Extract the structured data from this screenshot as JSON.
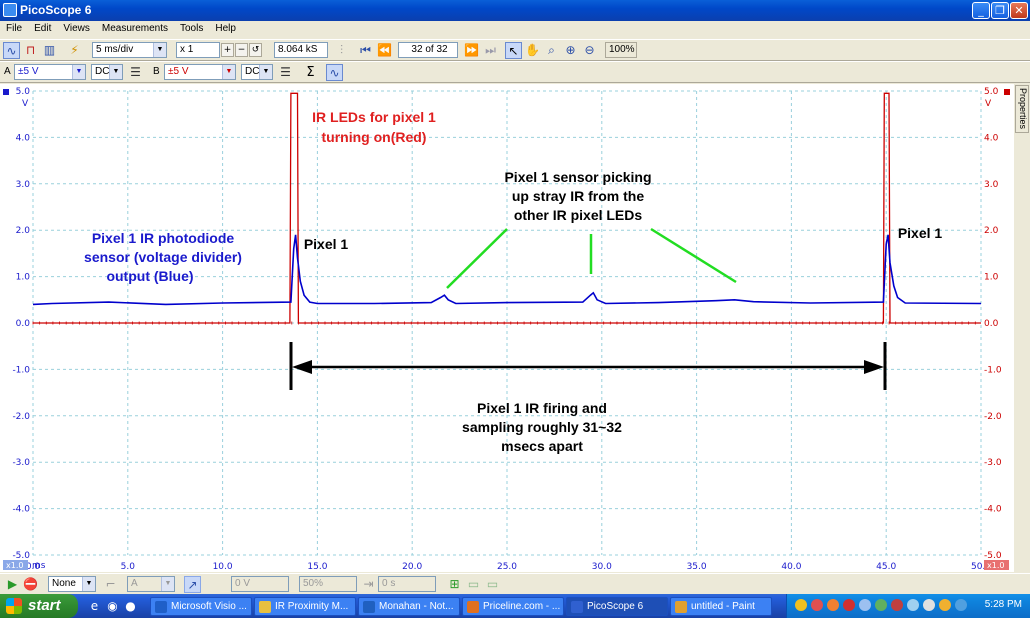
{
  "window": {
    "title": "PicoScope 6"
  },
  "menu": [
    "File",
    "Edit",
    "Views",
    "Measurements",
    "Tools",
    "Help"
  ],
  "toolbar1": {
    "timebase": "5 ms/div",
    "zoom": "x 1",
    "samples": "8.064 kS",
    "buffer": "32 of 32",
    "zoom_pct": "100%"
  },
  "toolbar2": {
    "chA_label": "A",
    "chA_range": "±5 V",
    "chA_coupling": "DC",
    "chB_label": "B",
    "chB_range": "±5 V",
    "chB_coupling": "DC",
    "sigma": "Σ"
  },
  "properties_tab": "Properties",
  "chart_data": {
    "type": "line",
    "xlim": [
      0,
      50
    ],
    "ylim": [
      -5,
      5
    ],
    "x_ticks": [
      "0.0",
      "5.0",
      "10.0",
      "15.0",
      "20.0",
      "25.0",
      "30.0",
      "35.0",
      "40.0",
      "45.0",
      "50.0"
    ],
    "y_ticks": [
      "5.0",
      "4.0",
      "3.0",
      "2.0",
      "1.0",
      "0.0",
      "-1.0",
      "-2.0",
      "-3.0",
      "-4.0",
      "-5.0"
    ],
    "y_unit": "V",
    "x_unit": "ms",
    "x_scale_badge": "x1.0",
    "grid": true,
    "series": [
      {
        "color": "#0000cc",
        "x": [
          0,
          1,
          4,
          7,
          10,
          13.6,
          13.75,
          13.85,
          13.95,
          14.1,
          14.3,
          14.6,
          15,
          18,
          21,
          21.5,
          21.7,
          21.9,
          22.3,
          25,
          29,
          29.4,
          29.55,
          29.75,
          30.2,
          33,
          36,
          37,
          38,
          41,
          44.85,
          45.0,
          45.1,
          45.2,
          45.4,
          45.6,
          46,
          50
        ],
        "y": [
          0.4,
          0.42,
          0.45,
          0.4,
          0.43,
          0.45,
          1.6,
          1.9,
          1.4,
          0.9,
          0.6,
          0.45,
          0.42,
          0.42,
          0.44,
          0.55,
          0.6,
          0.5,
          0.42,
          0.44,
          0.45,
          0.6,
          0.65,
          0.5,
          0.42,
          0.44,
          0.48,
          0.5,
          0.46,
          0.43,
          0.45,
          1.7,
          1.9,
          1.3,
          0.8,
          0.55,
          0.43,
          0.42
        ]
      },
      {
        "color": "#cc0000",
        "x": [
          0,
          13.55,
          13.6,
          13.95,
          14.0,
          44.85,
          44.9,
          45.15,
          45.2,
          50
        ],
        "y": [
          0.0,
          0.0,
          4.95,
          4.95,
          0.0,
          0.0,
          4.95,
          4.95,
          0.0,
          0.0
        ]
      }
    ],
    "annotations": [
      {
        "text": [
          "IR LEDs for pixel 1",
          "turning on(Red)"
        ],
        "color": "#e02020"
      },
      {
        "text": [
          "Pixel 1 IR photodiode",
          "sensor (voltage divider)",
          "output (Blue)"
        ],
        "color": "#1a1acc"
      },
      {
        "text": [
          "Pixel 1"
        ],
        "color": "#000000"
      },
      {
        "text": [
          "Pixel 1"
        ],
        "color": "#000000"
      },
      {
        "text": [
          "Pixel 1 sensor picking",
          "up stray IR from the",
          "other IR pixel LEDs"
        ],
        "color": "#000000"
      },
      {
        "text": [
          "Pixel 1 IR firing and",
          "sampling roughly 31~32",
          "msecs apart"
        ],
        "color": "#000000"
      }
    ]
  },
  "statusbar": {
    "trigger_mode": "None",
    "channel": "A",
    "level": "0 V",
    "pretrigger": "50%",
    "delay": "0 s"
  },
  "taskbar": {
    "start": "start",
    "tasks": [
      {
        "label": "Microsoft Visio ...",
        "color": "#1f5fc8"
      },
      {
        "label": "IR Proximity M...",
        "color": "#e8c040"
      },
      {
        "label": "Monahan - Not...",
        "color": "#2060c0"
      },
      {
        "label": "Priceline.com - ...",
        "color": "#e07020"
      },
      {
        "label": "PicoScope 6",
        "color": "#3060d0",
        "active": true
      },
      {
        "label": "untitled - Paint",
        "color": "#e0a030"
      }
    ],
    "clock": "5:28 PM"
  }
}
